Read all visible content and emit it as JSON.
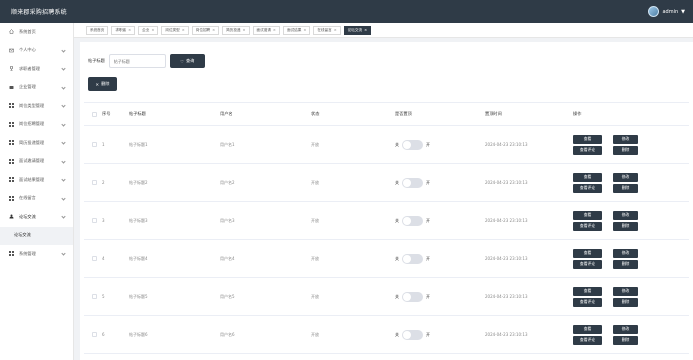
{
  "app": {
    "title": "顺来郡采购招聘系统"
  },
  "user": {
    "name": "admin"
  },
  "sidebar": {
    "items": [
      {
        "label": "系统首页",
        "icon": "home-icon"
      },
      {
        "label": "个人中心",
        "icon": "envelope-icon"
      },
      {
        "label": "求职者管理",
        "icon": "trophy-icon"
      },
      {
        "label": "企业管理",
        "icon": "user-card-icon"
      },
      {
        "label": "岗位类型管理",
        "icon": "grid-icon"
      },
      {
        "label": "岗位招聘管理",
        "icon": "grid-icon"
      },
      {
        "label": "简历投递管理",
        "icon": "grid-icon"
      },
      {
        "label": "面试邀请管理",
        "icon": "grid-icon"
      },
      {
        "label": "面试结果管理",
        "icon": "grid-icon"
      },
      {
        "label": "在线留言",
        "icon": "grid-icon"
      },
      {
        "label": "论坛交流",
        "icon": "person-icon"
      },
      {
        "label": "论坛交流",
        "icon": ""
      },
      {
        "label": "系统管理",
        "icon": "grid-icon"
      }
    ]
  },
  "tabs": [
    {
      "label": "系统首页",
      "closable": false
    },
    {
      "label": "求职者",
      "closable": true
    },
    {
      "label": "企业",
      "closable": true
    },
    {
      "label": "岗位类型",
      "closable": true
    },
    {
      "label": "岗位招聘",
      "closable": true
    },
    {
      "label": "简历投递",
      "closable": true
    },
    {
      "label": "面试邀请",
      "closable": true
    },
    {
      "label": "面试结果",
      "closable": true
    },
    {
      "label": "在线留言",
      "closable": true
    },
    {
      "label": "论坛交流",
      "closable": true,
      "active": true
    }
  ],
  "search": {
    "label": "帖子标题",
    "placeholder": "帖子标题",
    "button": "查询"
  },
  "toolbar": {
    "delete_label": "删除"
  },
  "table": {
    "headers": {
      "index": "序号",
      "title": "帖子标题",
      "user": "用户名",
      "status": "状态",
      "top": "是否置顶",
      "time": "置顶时间",
      "actions": "操作"
    },
    "switch": {
      "off": "关",
      "on": "开"
    },
    "buttons": {
      "view": "查看",
      "edit": "修改",
      "comments": "查看评论",
      "delete": "删除"
    },
    "rows": [
      {
        "index": "1",
        "title": "帖子标题1",
        "user": "用户名1",
        "status": "开放",
        "top": false,
        "time": "2024-04-23 23:10:13"
      },
      {
        "index": "2",
        "title": "帖子标题2",
        "user": "用户名2",
        "status": "开放",
        "top": false,
        "time": "2024-04-23 23:10:13"
      },
      {
        "index": "3",
        "title": "帖子标题3",
        "user": "用户名3",
        "status": "开放",
        "top": false,
        "time": "2024-04-23 23:10:13"
      },
      {
        "index": "4",
        "title": "帖子标题4",
        "user": "用户名4",
        "status": "开放",
        "top": false,
        "time": "2024-04-23 23:10:13"
      },
      {
        "index": "5",
        "title": "帖子标题5",
        "user": "用户名5",
        "status": "开放",
        "top": false,
        "time": "2024-04-23 23:10:13"
      },
      {
        "index": "6",
        "title": "帖子标题6",
        "user": "用户名6",
        "status": "开放",
        "top": false,
        "time": "2024-04-23 23:10:13"
      }
    ]
  }
}
